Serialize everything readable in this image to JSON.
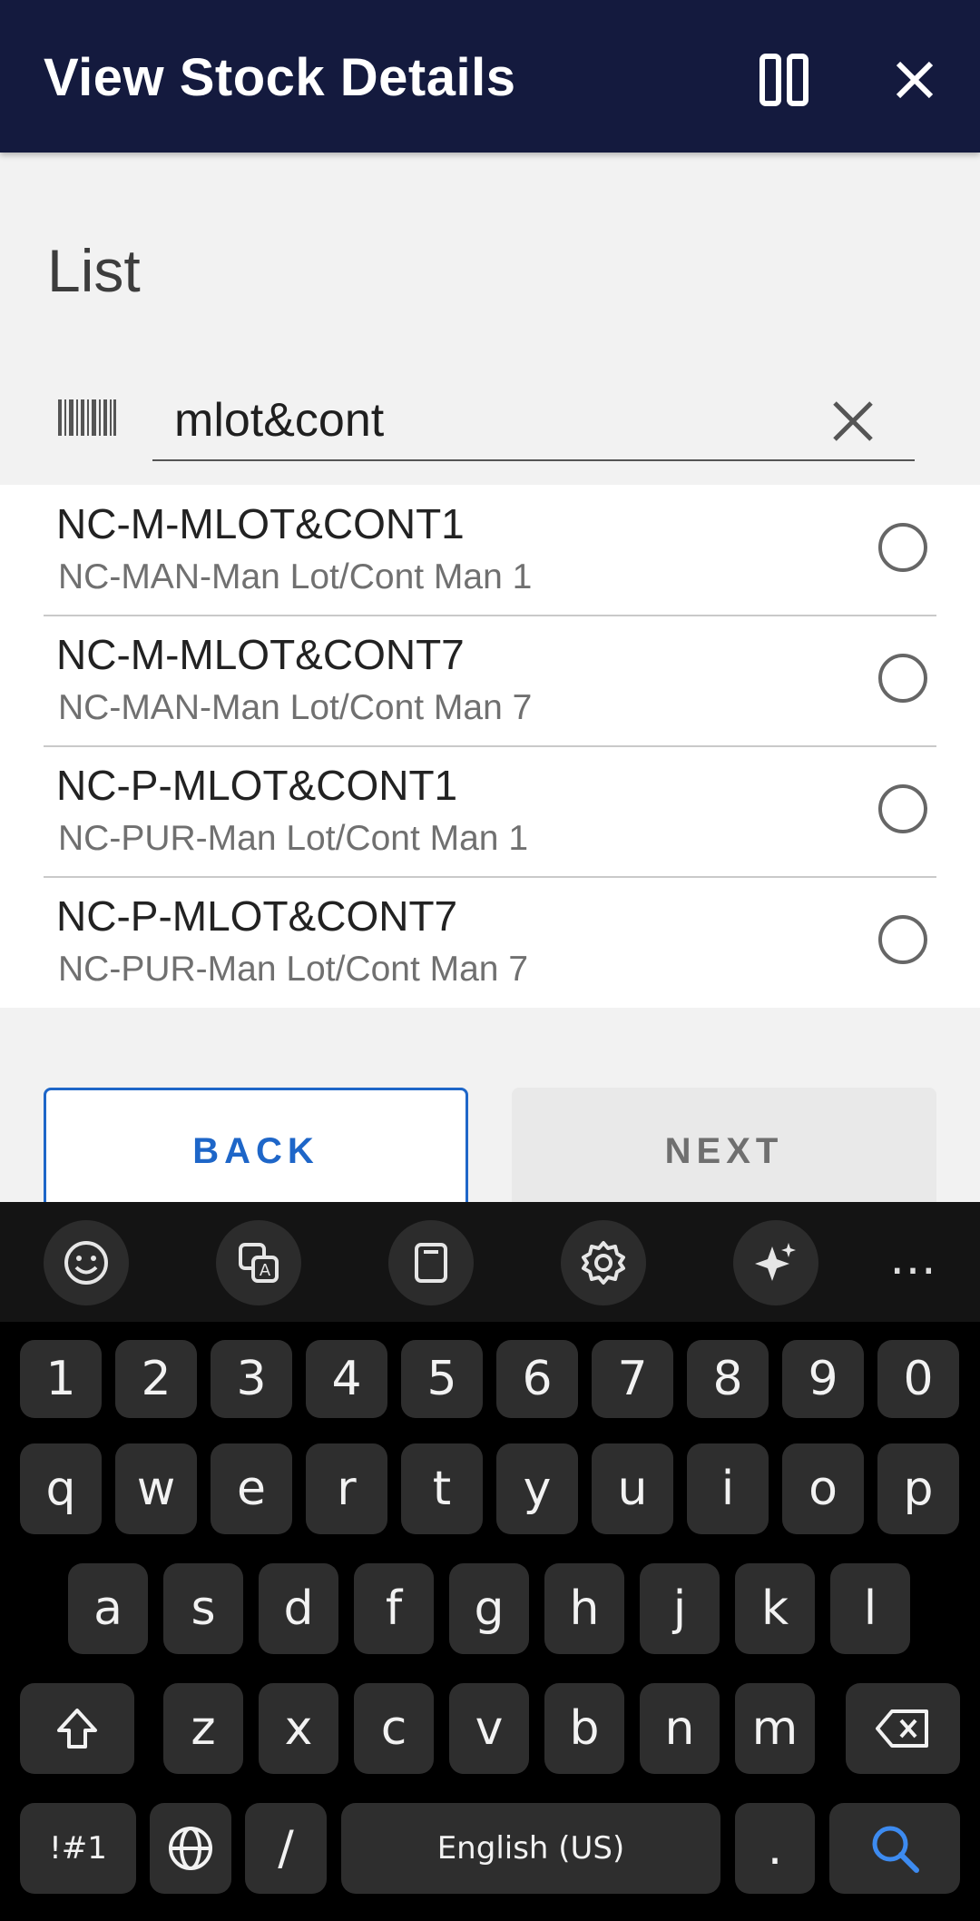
{
  "header": {
    "title": "View Stock Details"
  },
  "list_heading": "List",
  "search": {
    "value": "mlot&cont"
  },
  "items": [
    {
      "code": "NC-M-MLOT&CONT1",
      "desc": "NC-MAN-Man Lot/Cont Man 1"
    },
    {
      "code": "NC-M-MLOT&CONT7",
      "desc": "NC-MAN-Man Lot/Cont Man 7"
    },
    {
      "code": "NC-P-MLOT&CONT1",
      "desc": "NC-PUR-Man Lot/Cont Man 1"
    },
    {
      "code": "NC-P-MLOT&CONT7",
      "desc": "NC-PUR-Man Lot/Cont Man 7"
    }
  ],
  "buttons": {
    "back": "BACK",
    "next": "NEXT"
  },
  "keyboard": {
    "toolbar": [
      "emoji-icon",
      "translate-icon",
      "clipboard-icon",
      "settings-icon",
      "ai-sparkle-icon",
      "more-icon"
    ],
    "more_label": "…",
    "row_numbers": [
      "1",
      "2",
      "3",
      "4",
      "5",
      "6",
      "7",
      "8",
      "9",
      "0"
    ],
    "row1": [
      "q",
      "w",
      "e",
      "r",
      "t",
      "y",
      "u",
      "i",
      "o",
      "p"
    ],
    "row2": [
      "a",
      "s",
      "d",
      "f",
      "g",
      "h",
      "j",
      "k",
      "l"
    ],
    "row3": [
      "z",
      "x",
      "c",
      "v",
      "b",
      "n",
      "m"
    ],
    "symbols": "!#1",
    "slash": "/",
    "space": "English (US)",
    "period": "."
  },
  "colors": {
    "header_bg": "#141a3e",
    "accent": "#1e66c8",
    "keyboard_bg": "#000000",
    "key_bg": "#2e2e2e"
  }
}
